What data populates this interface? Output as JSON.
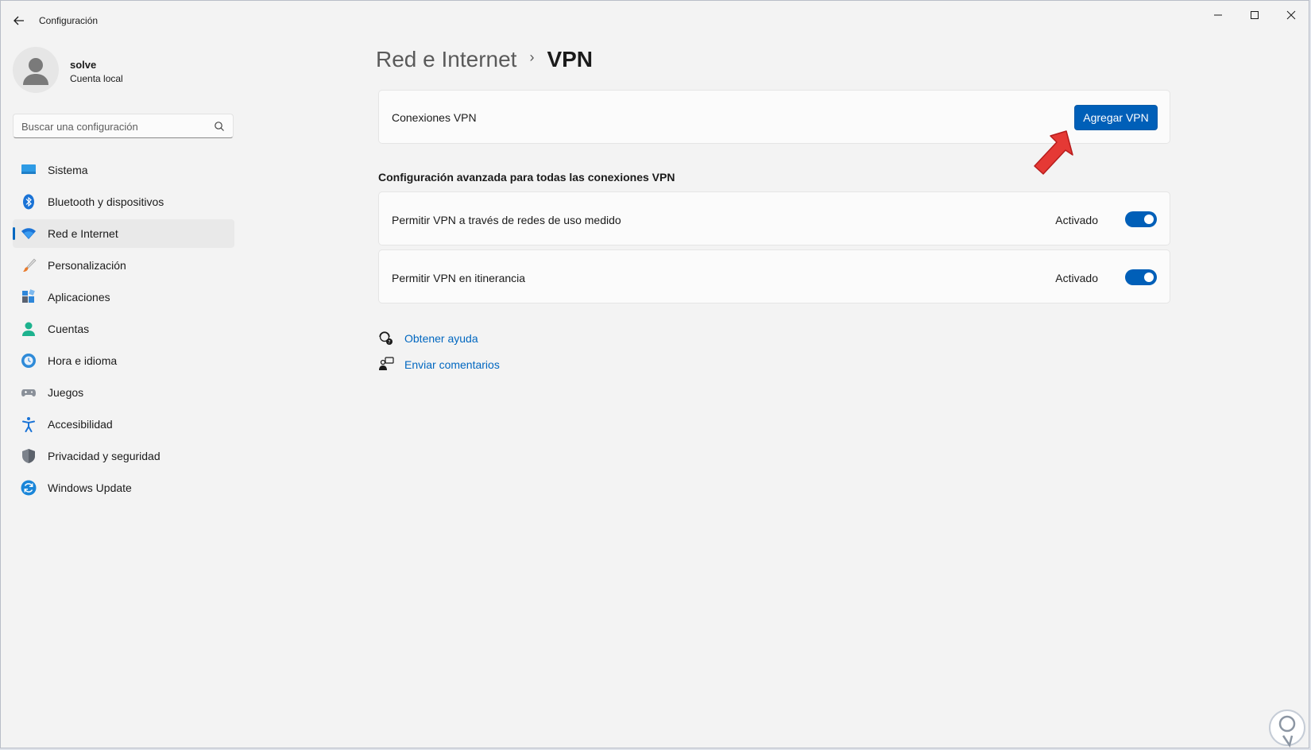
{
  "window": {
    "title": "Configuración",
    "controls": [
      "minimize",
      "maximize",
      "close"
    ]
  },
  "user": {
    "name": "solve",
    "account_type": "Cuenta local"
  },
  "search": {
    "placeholder": "Buscar una configuración"
  },
  "sidebar": {
    "items": [
      {
        "label": "Sistema",
        "icon": "system-icon",
        "active": false
      },
      {
        "label": "Bluetooth y dispositivos",
        "icon": "bluetooth-icon",
        "active": false
      },
      {
        "label": "Red e Internet",
        "icon": "wifi-icon",
        "active": true
      },
      {
        "label": "Personalización",
        "icon": "brush-icon",
        "active": false
      },
      {
        "label": "Aplicaciones",
        "icon": "apps-icon",
        "active": false
      },
      {
        "label": "Cuentas",
        "icon": "account-icon",
        "active": false
      },
      {
        "label": "Hora e idioma",
        "icon": "clock-globe-icon",
        "active": false
      },
      {
        "label": "Juegos",
        "icon": "gamepad-icon",
        "active": false
      },
      {
        "label": "Accesibilidad",
        "icon": "accessibility-icon",
        "active": false
      },
      {
        "label": "Privacidad y seguridad",
        "icon": "shield-icon",
        "active": false
      },
      {
        "label": "Windows Update",
        "icon": "update-icon",
        "active": false
      }
    ]
  },
  "breadcrumb": {
    "parent": "Red e Internet",
    "separator": "›",
    "current": "VPN"
  },
  "vpn_connections": {
    "label": "Conexiones VPN",
    "add_button": "Agregar VPN"
  },
  "advanced": {
    "title": "Configuración avanzada para todas las conexiones VPN",
    "settings": [
      {
        "label": "Permitir VPN a través de redes de uso medido",
        "state": "Activado",
        "on": true
      },
      {
        "label": "Permitir VPN en itinerancia",
        "state": "Activado",
        "on": true
      }
    ]
  },
  "links": {
    "help": "Obtener ayuda",
    "feedback": "Enviar comentarios"
  },
  "colors": {
    "accent": "#005fb8",
    "link": "#0067c0",
    "background": "#f3f3f3",
    "card": "#fbfbfb",
    "annotation_arrow": "#e53935"
  }
}
